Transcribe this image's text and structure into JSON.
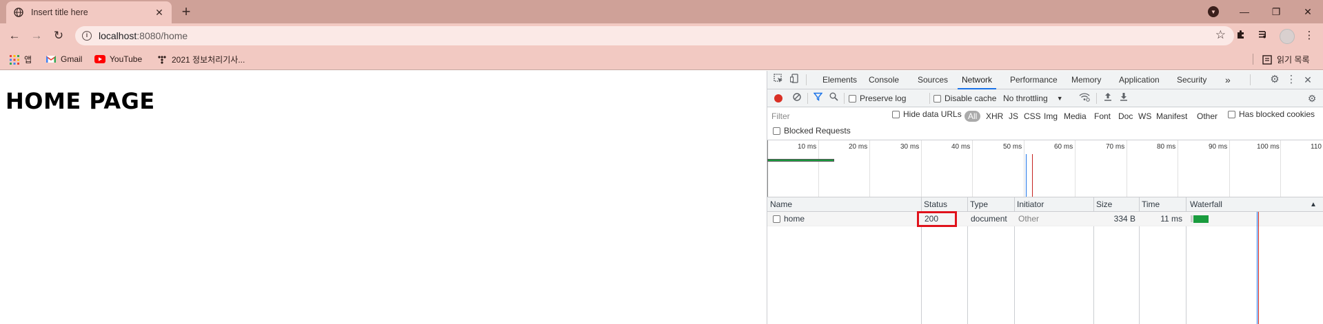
{
  "browser": {
    "tab_title": "Insert title here",
    "tab_close_glyph": "✕",
    "new_tab_glyph": "+",
    "url_host": "localhost",
    "url_rest": ":8080/home",
    "window_controls": [
      "—",
      "❐",
      "✕"
    ],
    "bookmarks": [
      "앱",
      "Gmail",
      "YouTube",
      "2021 정보처리기사..."
    ],
    "reading_list": "읽기 목록",
    "accent_color": "#cfa198"
  },
  "page": {
    "heading": "HOME PAGE"
  },
  "devtools": {
    "tabs": [
      "Elements",
      "Console",
      "Sources",
      "Network",
      "Performance",
      "Memory",
      "Application",
      "Security"
    ],
    "active_tab": "Network",
    "more_tabs": "»",
    "toolbar": {
      "preserve_log": "Preserve log",
      "disable_cache": "Disable cache",
      "throttling": "No throttling"
    },
    "filter": {
      "placeholder": "Filter",
      "hide_data_urls": "Hide data URLs",
      "types": [
        "All",
        "XHR",
        "JS",
        "CSS",
        "Img",
        "Media",
        "Font",
        "Doc",
        "WS",
        "Manifest",
        "Other"
      ],
      "has_blocked_cookies": "Has blocked cookies",
      "blocked_requests": "Blocked Requests"
    },
    "overview_ticks": [
      "10 ms",
      "20 ms",
      "30 ms",
      "40 ms",
      "50 ms",
      "60 ms",
      "70 ms",
      "80 ms",
      "90 ms",
      "100 ms",
      "110"
    ],
    "columns": [
      "Name",
      "Status",
      "Type",
      "Initiator",
      "Size",
      "Time",
      "Waterfall"
    ],
    "rows": [
      {
        "name": "home",
        "status": "200",
        "type": "document",
        "initiator": "Other",
        "size": "334 B",
        "time": "11 ms"
      }
    ]
  }
}
